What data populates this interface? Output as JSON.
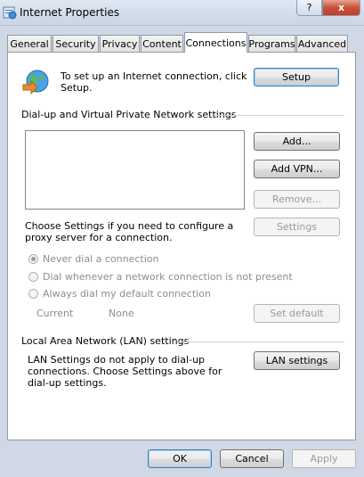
{
  "window": {
    "title": "Internet Properties",
    "help_glyph": "?",
    "close_glyph": "x"
  },
  "tabs": [
    {
      "label": "General"
    },
    {
      "label": "Security"
    },
    {
      "label": "Privacy"
    },
    {
      "label": "Content"
    },
    {
      "label": "Connections",
      "active": true
    },
    {
      "label": "Programs"
    },
    {
      "label": "Advanced"
    }
  ],
  "setup": {
    "text": "To set up an Internet connection, click Setup.",
    "button": "Setup"
  },
  "dialup": {
    "heading": "Dial-up and Virtual Private Network settings",
    "add_button": "Add...",
    "add_vpn_button": "Add VPN...",
    "remove_button": "Remove...",
    "proxy_text": "Choose Settings if you need to configure a proxy server for a connection.",
    "settings_button": "Settings",
    "radio_never": "Never dial a connection",
    "radio_whenever": "Dial whenever a network connection is not present",
    "radio_always": "Always dial my default connection",
    "current_label": "Current",
    "current_value": "None",
    "set_default_button": "Set default"
  },
  "lan": {
    "heading": "Local Area Network (LAN) settings",
    "text": "LAN Settings do not apply to dial-up connections. Choose Settings above for dial-up settings.",
    "button": "LAN settings"
  },
  "footer": {
    "ok": "OK",
    "cancel": "Cancel",
    "apply": "Apply"
  },
  "colors": {
    "accent": "#3c7fb1",
    "close": "#c8503a"
  }
}
